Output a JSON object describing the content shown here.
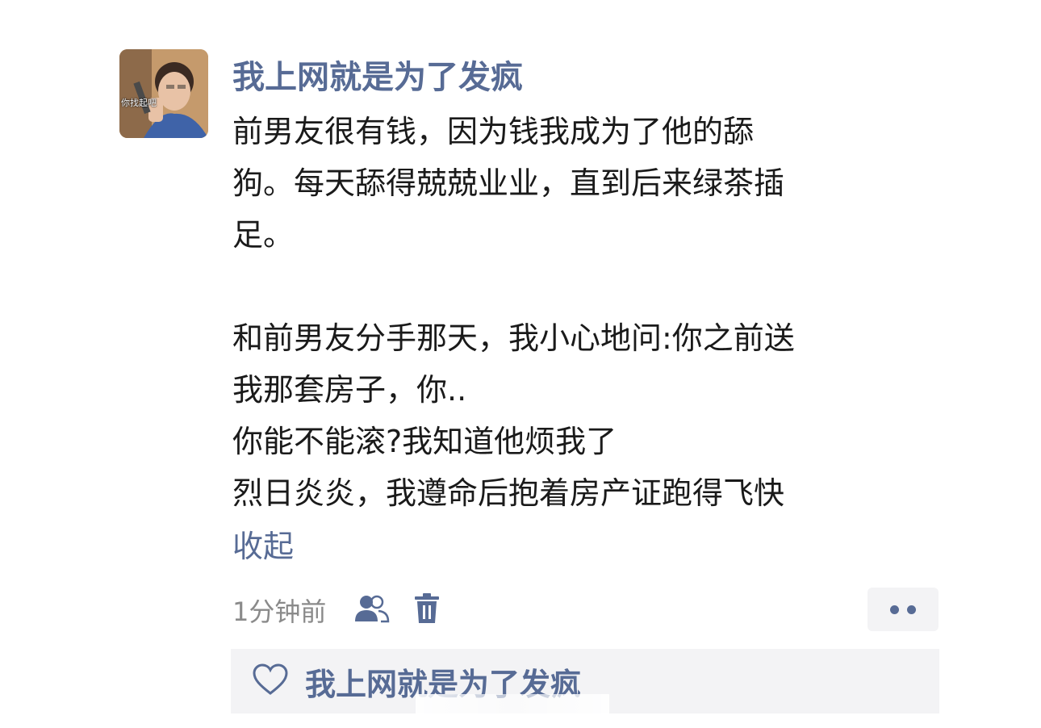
{
  "post": {
    "author": "我上网就是为了发疯",
    "avatar_caption": "你找起吧",
    "lines": [
      "前男友很有钱，因为钱我成为了他的舔",
      "狗。每天舔得兢兢业业，直到后来绿茶插",
      "足。",
      "",
      "和前男友分手那天，我小心地问:你之前送",
      "我那套房子，你..",
      "你能不能滚?我知道他烦我了",
      "烈日炎炎，我遵命后抱着房产证跑得飞快"
    ],
    "collapse_label": "收起",
    "timestamp": "1分钟前"
  },
  "icons": {
    "visibility": "people-icon",
    "delete": "trash-icon",
    "more": "more-dots-icon",
    "like": "heart-icon"
  },
  "likes": {
    "names": "我上网就是为了发疯"
  },
  "colors": {
    "link": "#576b95",
    "text": "#1a1a1a",
    "meta": "#8a8a8a",
    "panel_bg": "#f3f3f5"
  }
}
